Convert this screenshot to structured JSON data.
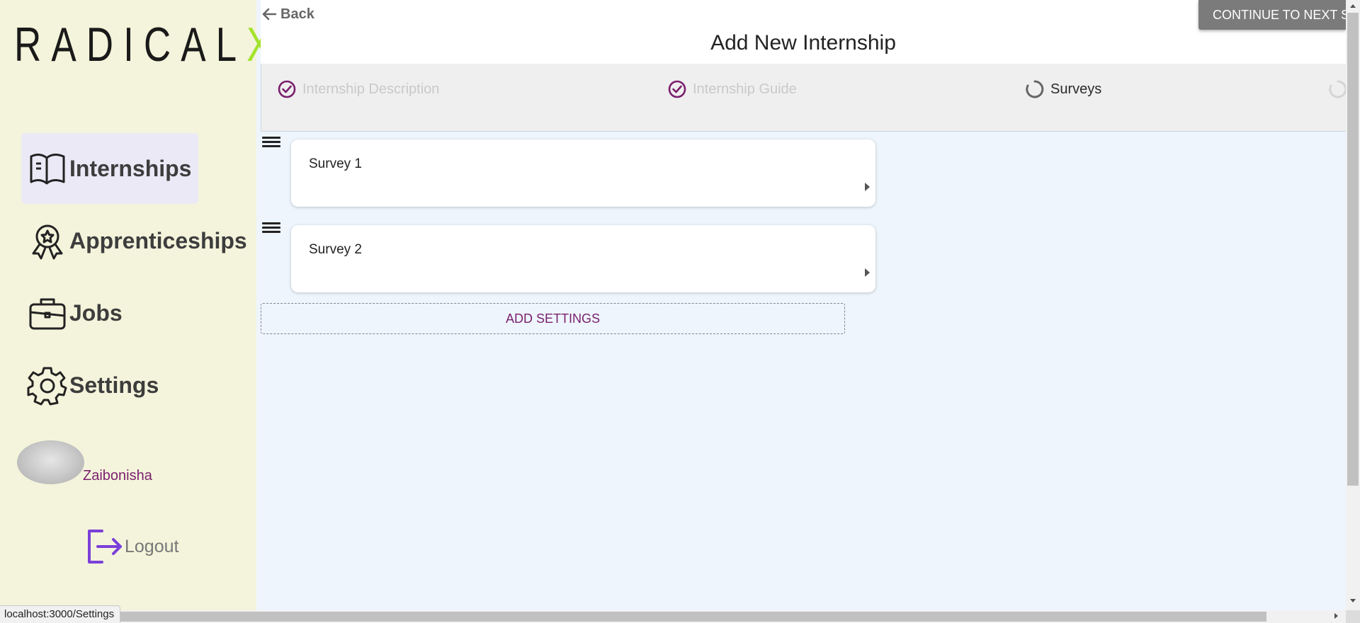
{
  "sidebar": {
    "logo_main": "RADICAL",
    "logo_accent": "X",
    "items": [
      {
        "label": "Internships",
        "icon": "book-icon"
      },
      {
        "label": "Apprenticeships",
        "icon": "award-icon"
      },
      {
        "label": "Jobs",
        "icon": "briefcase-icon"
      },
      {
        "label": "Settings",
        "icon": "gear-icon"
      }
    ],
    "user_name": "Zaibonisha",
    "logout_label": "Logout"
  },
  "header": {
    "back_label": "Back",
    "title": "Add New Internship",
    "continue_label": "CONTINUE TO NEXT STEP"
  },
  "stepper": {
    "steps": [
      {
        "label": "Internship Description",
        "status": "done"
      },
      {
        "label": "Internship Guide",
        "status": "done"
      },
      {
        "label": "Surveys",
        "status": "current"
      },
      {
        "label": "",
        "status": "pending"
      }
    ]
  },
  "surveys": [
    {
      "title": "Survey 1"
    },
    {
      "title": "Survey 2"
    }
  ],
  "add_settings_label": "ADD SETTINGS",
  "status_bar_url": "localhost:3000/Settings",
  "colors": {
    "sidebar_bg": "#f4f4dc",
    "accent_purple": "#7a1f6d",
    "logo_accent": "#a4e22c",
    "content_bg": "#eef5fd"
  }
}
